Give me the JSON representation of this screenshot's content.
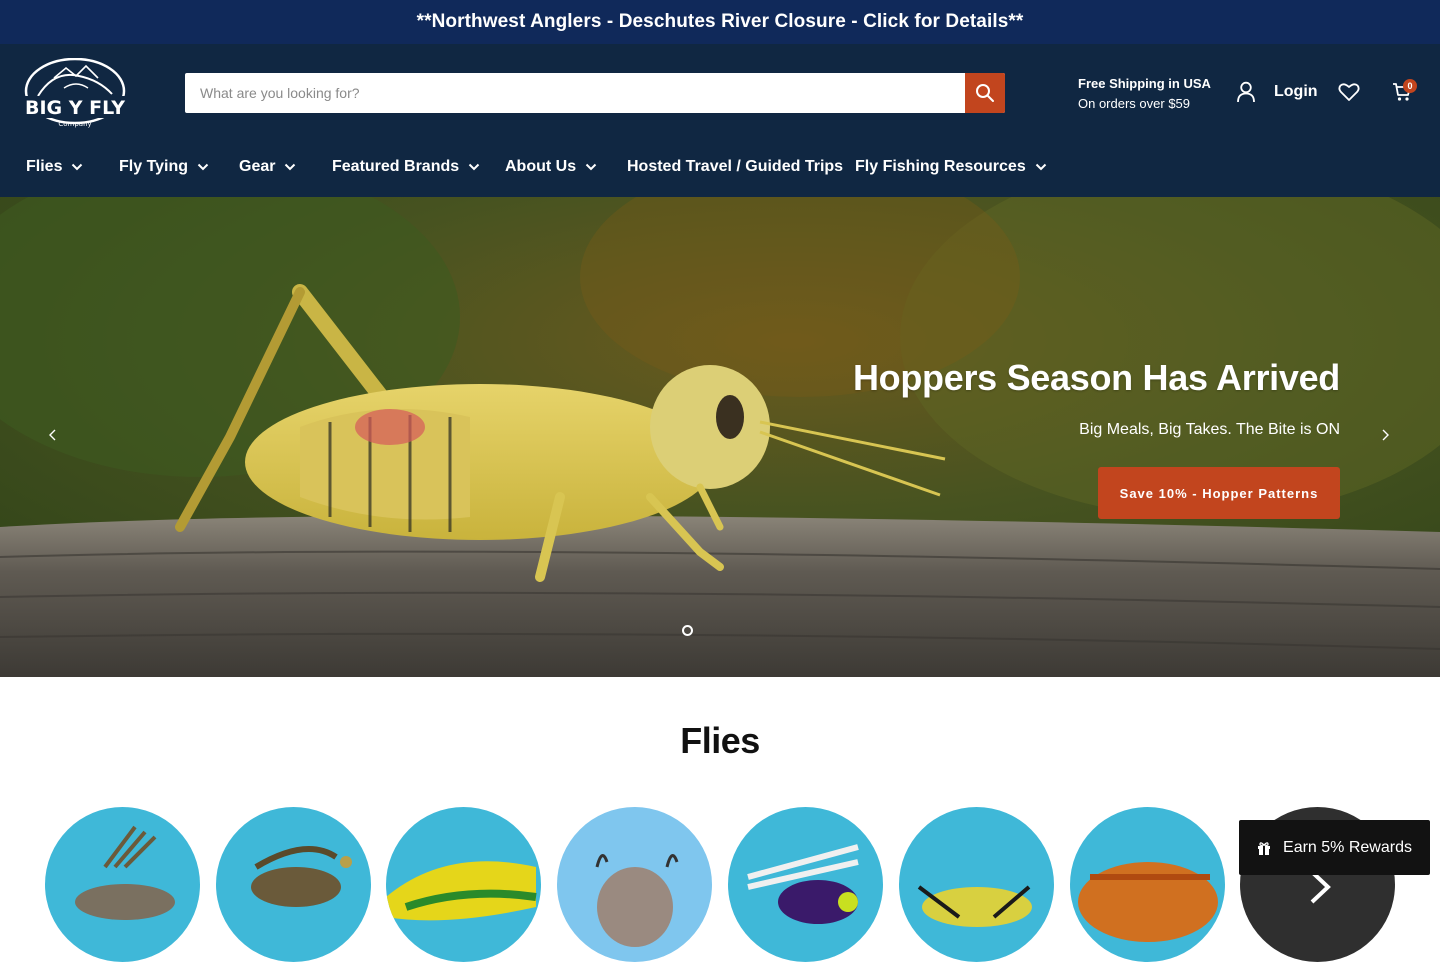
{
  "announcement": {
    "text": "**Northwest Anglers - Deschutes River Closure - Click for Details**"
  },
  "header": {
    "logo_text": "BIG Y FLY",
    "logo_subtext": "Company",
    "search": {
      "placeholder": "What are you looking for?",
      "value": ""
    },
    "shipping": {
      "title": "Free Shipping in USA",
      "subtitle": "On orders over $59"
    },
    "login_label": "Login",
    "cart_count": "0"
  },
  "nav": {
    "items": [
      {
        "label": "Flies",
        "has_dropdown": true
      },
      {
        "label": "Fly Tying",
        "has_dropdown": true
      },
      {
        "label": "Gear",
        "has_dropdown": true
      },
      {
        "label": "Featured Brands",
        "has_dropdown": true
      },
      {
        "label": "About Us",
        "has_dropdown": true
      },
      {
        "label": "Hosted Travel / Guided Trips",
        "has_dropdown": false
      },
      {
        "label": "Fly Fishing Resources",
        "has_dropdown": true
      }
    ]
  },
  "hero": {
    "title": "Hoppers Season Has Arrived",
    "subtitle": "Big Meals, Big Takes. The Bite is ON",
    "button_label": "Save 10% - Hopper Patterns"
  },
  "flies_section": {
    "title": "Flies",
    "count_visible": 8
  },
  "rewards": {
    "label": "Earn 5% Rewards"
  },
  "colors": {
    "announcement_bg": "#10295a",
    "header_bg": "#102742",
    "accent": "#c2451e",
    "rewards_bg": "#121212"
  }
}
